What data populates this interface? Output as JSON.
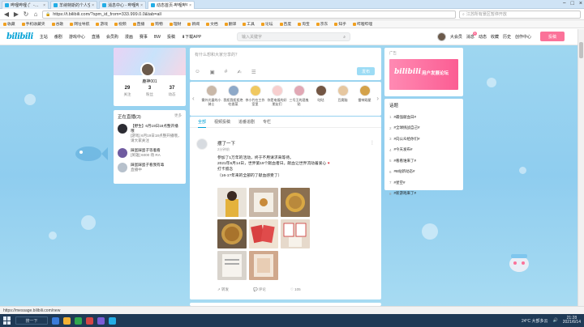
{
  "browser": {
    "tabs": [
      {
        "title": "哔哩哔哩 (゜-゜)つロ 干杯~-bilibili",
        "active": false
      },
      {
        "title": "羊纳特斯的个人空间_哔哩哔哩",
        "active": false
      },
      {
        "title": "消息中心 - 哔哩哔哩弹幕视频网",
        "active": false
      },
      {
        "title": "动态首页-哔哩哔哩",
        "active": true
      }
    ],
    "window_controls": [
      "−",
      "□",
      "×"
    ],
    "nav": {
      "back": "◀",
      "forward": "▶",
      "refresh": "↻",
      "home": "⌂"
    },
    "url": "https://t.bilibili.com/?spm_id_from=333.999.0.0&tab=all",
    "search_placeholder": "江苏所有景区暂停开放",
    "bookmarks": [
      "收藏",
      "手机收藏夹",
      "谷歌",
      "网址导航",
      "游戏",
      "视频",
      "直播",
      "购物",
      "理财",
      "新闻",
      "文档",
      "翻译",
      "工具",
      "论坛",
      "百度",
      "淘宝",
      "京东",
      "知乎",
      "哔哩哔哩"
    ]
  },
  "bili_header": {
    "logo": "bilibili",
    "nav": [
      "主站",
      "番剧",
      "游戏中心",
      "直播",
      "会员购",
      "漫画",
      "赛事",
      "BW",
      "投稿",
      "下载APP"
    ],
    "search_placeholder": "输入关键字",
    "right_nav": [
      "大会员",
      "消息",
      "动态",
      "收藏",
      "历史",
      "创作中心"
    ],
    "message_badge": "1",
    "upload": "投稿"
  },
  "profile": {
    "username": "鹿神001",
    "stats": [
      {
        "value": "29",
        "label": "关注"
      },
      {
        "value": "3",
        "label": "粉丝"
      },
      {
        "value": "37",
        "label": "动态"
      }
    ]
  },
  "live": {
    "title": "正在直播",
    "count_label": "(3)",
    "more": "更多",
    "items": [
      {
        "name": "【野生】6月19日18点整开播哦",
        "sub": "[游戏] 6月19日18点整开播哦，请大家关注",
        "color": "#2c2c33"
      },
      {
        "name": "踩蛋踩蛋子等着看",
        "sub": "[英雄] 6000 场 RA",
        "color": "#6f5ba0"
      },
      {
        "name": "踩蛋踩蛋子看我有毒",
        "sub": "直播中",
        "color": "#b7c1cc"
      }
    ]
  },
  "compose": {
    "placeholder": "有什么想和大家分享的？",
    "tools": [
      "☺",
      "▣",
      "#",
      "✍",
      "☰"
    ],
    "send": "发布"
  },
  "up_list": {
    "items": [
      {
        "name": "雾外光量的小骑士",
        "color": "#c9b8a8"
      },
      {
        "name": "我拒我拒拒绝吃香菜",
        "color": "#8ea9c8"
      },
      {
        "name": "李小竹在工作室里",
        "color": "#f0c860"
      },
      {
        "name": "你是电报的好朋友们",
        "color": "#f7cfcf"
      },
      {
        "name": "三号王的酒鬼贴",
        "color": "#e1a8b5"
      },
      {
        "name": "咕咕",
        "color": "#735644"
      },
      {
        "name": "豆腐脑",
        "color": "#e6c7a0"
      },
      {
        "name": "雷神观星",
        "color": "#d4a24a"
      }
    ]
  },
  "feed": {
    "tabs": [
      "全部",
      "视频投稿",
      "追番追剧",
      "专栏"
    ],
    "active_tab": "全部",
    "post": {
      "author": "摆了一下",
      "time": "2分钟前",
      "lines": [
        "参加了1万年的活动，终于不用请求来等待。",
        "2021年6月14日，世界第19个献血者日。献血让世界流动着爱心",
        "打卡留念",
        "（16-1?年来的全部的了献血感受了）"
      ],
      "photos": [
        {
          "label": "person",
          "color": "#e4b23c"
        },
        {
          "label": "certificate",
          "color": "#c9b8a8"
        },
        {
          "label": "coin",
          "color": "#b9893c"
        },
        {
          "label": "coin",
          "color": "#a8732c"
        },
        {
          "label": "envelopes",
          "color": "#d84040"
        },
        {
          "label": "certificates",
          "color": "#e6d9cb"
        },
        {
          "label": "doc",
          "color": "#d8d3cc"
        },
        {
          "label": "doc",
          "color": "#d0a88c"
        }
      ],
      "actions": [
        "↗ 转发",
        "💬 评论",
        "♡ 105"
      ]
    }
  },
  "ad": {
    "tag": "广告",
    "brand": "bilibili",
    "text": "用户发展论坛"
  },
  "topics": {
    "title": "话题",
    "items": [
      {
        "rank": "1",
        "text": "#最强献血日#"
      },
      {
        "rank": "2",
        "text": "#全球挑战自己#"
      },
      {
        "rank": "3",
        "text": "#向公众给你们#"
      },
      {
        "rank": "4",
        "text": "#今天发布#"
      },
      {
        "rank": "5",
        "text": "#看看谁来了#"
      },
      {
        "rank": "6",
        "text": "#B站新动态#"
      },
      {
        "rank": "7",
        "text": "#星空#"
      },
      {
        "rank": "8",
        "text": "#新游戏来了#"
      }
    ]
  },
  "status_url": "https://message.bilibili.com/new",
  "taskbar": {
    "search": "搜一下",
    "weather": "24°C 大部多云",
    "time": "21:28",
    "date": "2021/6/14"
  }
}
